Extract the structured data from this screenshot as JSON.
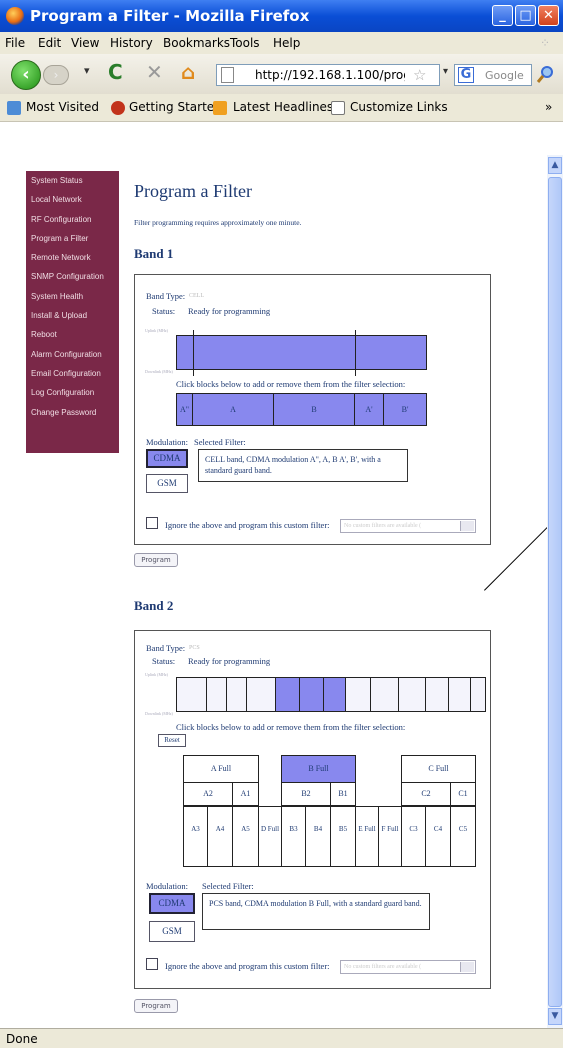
{
  "window": {
    "title": "Program a Filter - Mozilla Firefox"
  },
  "menu": [
    "File",
    "Edit",
    "View",
    "History",
    "Bookmarks",
    "Tools",
    "Help"
  ],
  "nav": {
    "url": "http://192.168.1.100/progr",
    "search_placeholder": "Google"
  },
  "bookmarks": [
    "Most Visited",
    "Getting Started",
    "Latest Headlines",
    "Customize Links"
  ],
  "bookmarks_more": "»",
  "status": "Done",
  "sidebar": [
    "System Status",
    "Local Network",
    "RF Configuration",
    "Program a Filter",
    "Remote Network",
    "SNMP Configuration",
    "System Health",
    "Install & Upload",
    "Reboot",
    "Alarm Configuration",
    "Email Configuration",
    "Log Configuration",
    "Change Password"
  ],
  "page": {
    "title": "Program a Filter",
    "note": "Filter programming requires approximately one minute."
  },
  "band1": {
    "heading": "Band 1",
    "band_type_label": "Band Type:",
    "band_type_value": "CELL",
    "status_label": "Status:",
    "status_value": "Ready for programming",
    "uplink_label": "Uplink (MHz)",
    "downlink_label": "Downlink (MHz)",
    "instruction": "Click blocks below to add or remove them from the filter selection:",
    "blocks": [
      "A\"",
      "A",
      "B",
      "A'",
      "B'"
    ],
    "modulation_label": "Modulation:",
    "selected_label": "Selected Filter:",
    "cdma": "CDMA",
    "gsm": "GSM",
    "selected_text": "CELL band, CDMA modulation A\", A, B A', B', with a standard guard band.",
    "ignore_label": "Ignore the above and program this custom filter:",
    "custom_placeholder": "No custom filters are available (",
    "program": "Program"
  },
  "band2": {
    "heading": "Band 2",
    "band_type_label": "Band Type:",
    "band_type_value": "PCS",
    "status_label": "Status:",
    "status_value": "Ready for programming",
    "uplink_label": "Uplink (MHz)",
    "downlink_label": "Downlink (MHz)",
    "instruction": "Click blocks below to add or remove them from the filter selection:",
    "reset": "Reset",
    "row1": [
      "A Full",
      "B Full",
      "C Full"
    ],
    "row2": [
      "A2",
      "A1",
      "B2",
      "B1",
      "C2",
      "C1"
    ],
    "row3": [
      "A3",
      "A4",
      "A5",
      "D Full",
      "B3",
      "B4",
      "B5",
      "E Full",
      "F Full",
      "C3",
      "C4",
      "C5"
    ],
    "modulation_label": "Modulation:",
    "selected_label": "Selected Filter:",
    "cdma": "CDMA",
    "gsm": "GSM",
    "selected_text": "PCS band, CDMA modulation B Full, with a standard guard band.",
    "ignore_label": "Ignore the above and program this custom filter:",
    "custom_placeholder": "No custom filters are available (",
    "program": "Program"
  }
}
